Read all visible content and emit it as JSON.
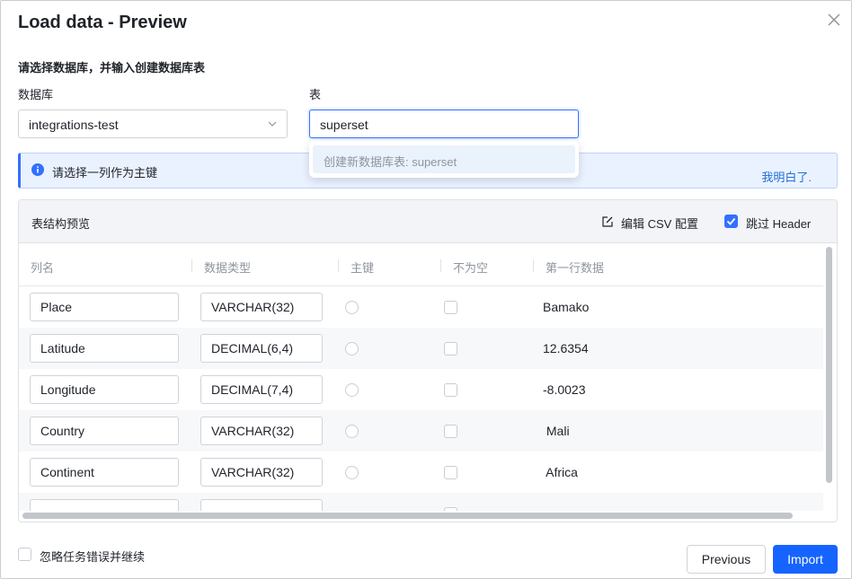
{
  "dialog": {
    "title": "Load data - Preview",
    "section_title": "请选择数据库，并输入创建数据库表",
    "database_label": "数据库",
    "table_label": "表",
    "database_value": "integrations-test",
    "table_value": "superset",
    "dropdown_option": "创建新数据库表: superset",
    "info_text": "请选择一列作为主键",
    "info_link": "我明白了.",
    "preview_title": "表结构预览",
    "edit_csv_label": "编辑 CSV 配置",
    "skip_header_label": "跳过 Header",
    "skip_header_checked": true,
    "columns": [
      "列名",
      "数据类型",
      "主键",
      "不为空",
      "第一行数据"
    ],
    "rows": [
      {
        "name": "Place",
        "type": "VARCHAR(32)",
        "first": "Bamako"
      },
      {
        "name": " Latitude",
        "type": "DECIMAL(6,4)",
        "first": "12.6354"
      },
      {
        "name": " Longitude",
        "type": "DECIMAL(7,4)",
        "first": "-8.0023"
      },
      {
        "name": " Country",
        "type": "VARCHAR(32)",
        "first": " Mali"
      },
      {
        "name": " Continent",
        "type": "VARCHAR(32)",
        "first": " Africa"
      }
    ],
    "ignore_errors_label": "忽略任务错误并继续",
    "previous_label": "Previous",
    "import_label": "Import",
    "colors": {
      "accent": "#1664ff",
      "info_bg": "#eaf2ff",
      "link": "#1e6fd9"
    },
    "icons": {
      "close": "close-icon",
      "chevron": "chevron-down-icon",
      "info": "info-icon",
      "edit": "edit-icon",
      "check": "check-icon"
    }
  }
}
